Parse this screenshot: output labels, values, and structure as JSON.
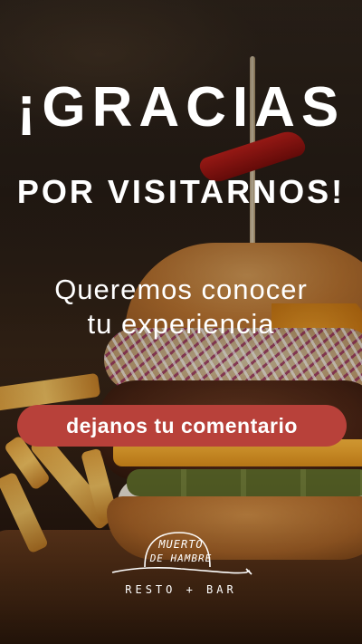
{
  "headline": {
    "line1": "¡GRACIAS",
    "line2": "POR VISITARNOS!"
  },
  "subtitle": {
    "line1": "Queremos conocer",
    "line2": "tu experiencia"
  },
  "cta": {
    "label": "dejanos tu comentario",
    "color": "#b8413a"
  },
  "logo": {
    "line1": "MUERTO",
    "line2": "DE HAMBRE",
    "tagline": "RESTO + BAR"
  }
}
